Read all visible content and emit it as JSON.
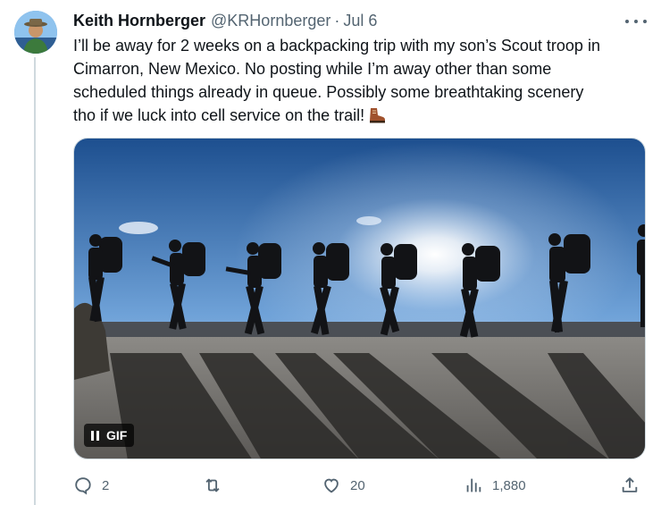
{
  "tweet": {
    "author_name": "Keith Hornberger",
    "handle": "@KRHornberger",
    "separator": "·",
    "date": "Jul 6",
    "text_lines": [
      "I’ll be away for 2 weeks on a backpacking trip with my son’s Scout troop in",
      "Cimarron, New Mexico. No posting while I’m away other than some",
      "scheduled things already in queue. Possibly some breathtaking scenery",
      "tho if we luck into cell service on the trail!"
    ],
    "emoji": "hiking-boot",
    "media": {
      "type": "gif",
      "badge_label": "GIF",
      "description_icon": "hikers-silhouette-sunset"
    },
    "actions": {
      "replies": "2",
      "retweets": "",
      "likes": "20",
      "views": "1,880"
    },
    "icons": {
      "more": "more-icon",
      "reply": "reply-icon",
      "retweet": "retweet-icon",
      "like": "heart-icon",
      "views": "views-icon",
      "share": "share-icon"
    },
    "colors": {
      "text": "#0f1419",
      "secondary": "#536471",
      "border": "#cfd9de"
    }
  }
}
